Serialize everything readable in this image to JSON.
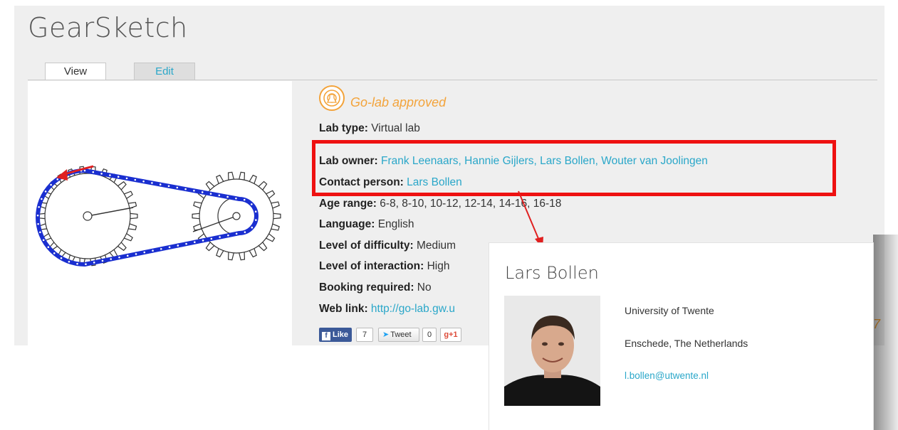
{
  "page": {
    "title": "GearSketch",
    "tabs": [
      {
        "label": "View"
      },
      {
        "label": "Edit"
      }
    ]
  },
  "lab": {
    "approved_label": "Go-lab approved",
    "type_label": "Lab type:",
    "type_value": "Virtual lab",
    "owner_label": "Lab owner:",
    "owner_value": "Frank Leenaars, Hannie Gijlers, Lars Bollen, Wouter van Joolingen",
    "contact_label": "Contact person:",
    "contact_value": "Lars Bollen",
    "age_label": "Age range:",
    "age_value": "6-8, 8-10, 10-12, 12-14, 14-16, 16-18",
    "language_label": "Language:",
    "language_value": "English",
    "difficulty_label": "Level of difficulty:",
    "difficulty_value": "Medium",
    "interaction_label": "Level of interaction:",
    "interaction_value": "High",
    "booking_label": "Booking required:",
    "booking_value": "No",
    "weblink_label": "Web link:",
    "weblink_value": "http://go-lab.gw.u"
  },
  "social": {
    "like_label": "Like",
    "like_count": "7",
    "tweet_label": "Tweet",
    "tweet_count": "0",
    "gplus_label": "g+1"
  },
  "popup": {
    "name": "Lars Bollen",
    "university": "University of Twente",
    "location": "Enschede, The Netherlands",
    "email": "l.bollen@utwente.nl"
  },
  "colors": {
    "accent": "#2aa7c9",
    "approved": "#f3a33a",
    "highlight": "#ee1111",
    "chain": "#1a2fd0"
  }
}
